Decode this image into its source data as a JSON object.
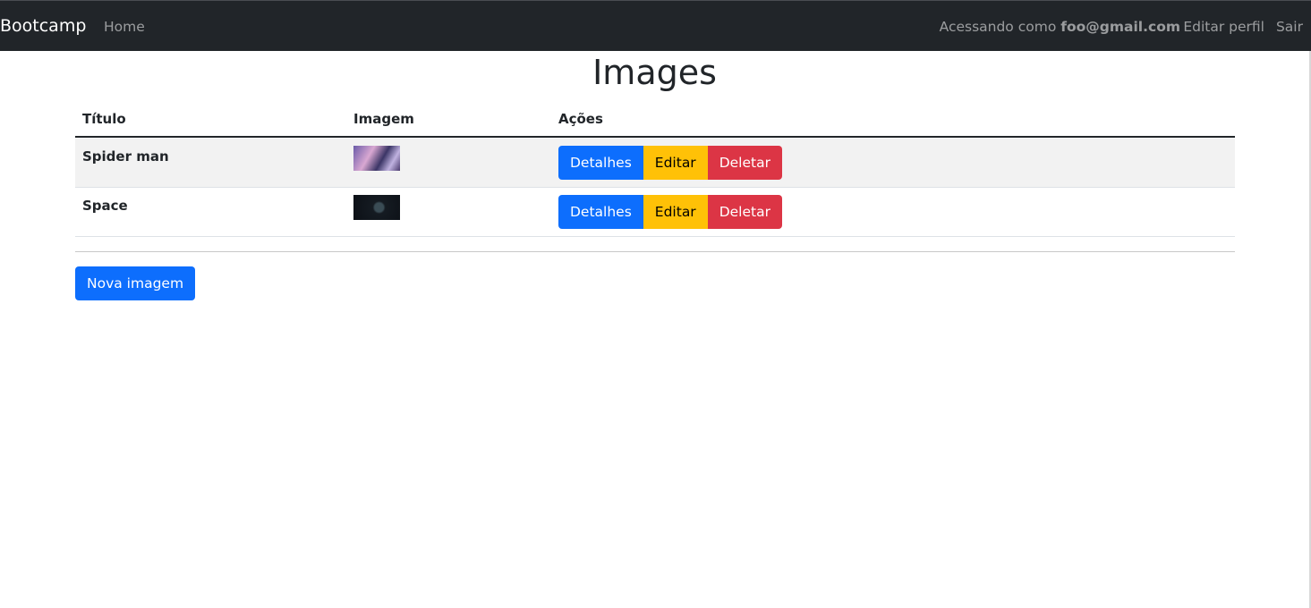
{
  "navbar": {
    "brand": "Bootcamp",
    "home_label": "Home",
    "user_prefix": "Acessando como",
    "user_email": "foo@gmail.com",
    "edit_profile_label": "Editar perfil",
    "logout_label": "Sair"
  },
  "page": {
    "title": "Images"
  },
  "table": {
    "headers": {
      "title": "Título",
      "image": "Imagem",
      "actions": "Ações"
    },
    "rows": [
      {
        "title": "Spider man",
        "thumbnail": "spider-man-image",
        "actions": {
          "details": "Detalhes",
          "edit": "Editar",
          "delete": "Deletar"
        }
      },
      {
        "title": "Space",
        "thumbnail": "space-image",
        "actions": {
          "details": "Detalhes",
          "edit": "Editar",
          "delete": "Deletar"
        }
      }
    ]
  },
  "new_image_label": "Nova imagem",
  "colors": {
    "navbar_bg": "#212529",
    "primary": "#0d6efd",
    "warning": "#ffc107",
    "danger": "#dc3545",
    "striped_row": "#f2f2f2"
  }
}
